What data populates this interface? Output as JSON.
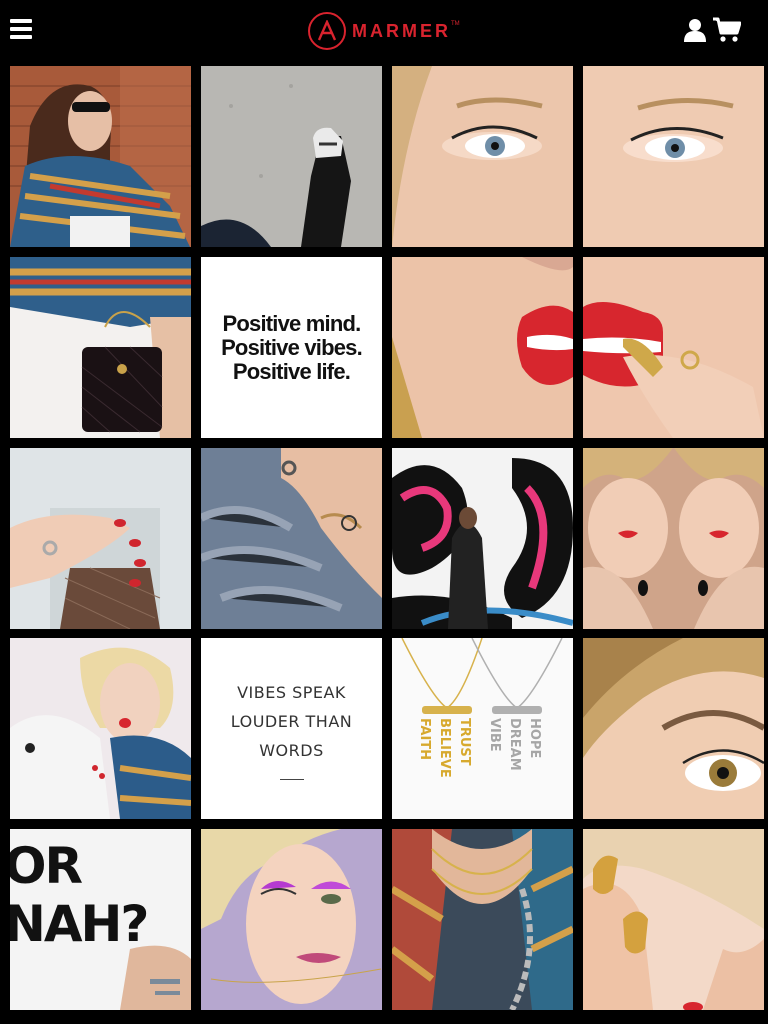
{
  "header": {
    "brand": "MARMER",
    "trademark": "TM",
    "icons": [
      "menu-icon",
      "user-icon",
      "cart-icon"
    ]
  },
  "colors": {
    "brand_red": "#d9232e",
    "background": "#000000",
    "tile_white": "#ffffff"
  },
  "grid": {
    "columns": 4,
    "rows": 5,
    "quote_positive": [
      "Positive mind.",
      "Positive vibes.",
      "Positive life."
    ],
    "quote_vibes": [
      "VIBES SPEAK",
      "LOUDER THAN",
      "WORDS"
    ],
    "tee_text": "OR NAH?",
    "necklace_gold": [
      "FAITH",
      "BELIEVE",
      "TRUST"
    ],
    "necklace_silver": [
      "VIBE",
      "DREAM",
      "HOPE"
    ]
  }
}
